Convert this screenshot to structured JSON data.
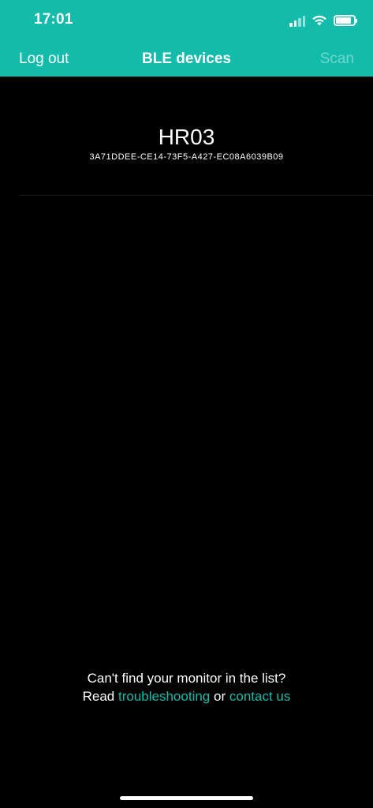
{
  "status_bar": {
    "time": "17:01",
    "battery_level": 0.85
  },
  "nav": {
    "left_label": "Log out",
    "title": "BLE devices",
    "right_label": "Scan"
  },
  "devices": [
    {
      "name": "HR03",
      "id": "3A71DDEE-CE14-73F5-A427-EC08A6039B09"
    }
  ],
  "help": {
    "question": "Can't find your monitor in the list?",
    "read_prefix": "Read",
    "troubleshooting_link": "troubleshooting",
    "connector": "or",
    "contact_link": "contact us"
  },
  "colors": {
    "header_bg": "#13bcaa",
    "link": "#13bcaa",
    "scan_disabled": "#6fd7cc",
    "background": "#000000"
  }
}
